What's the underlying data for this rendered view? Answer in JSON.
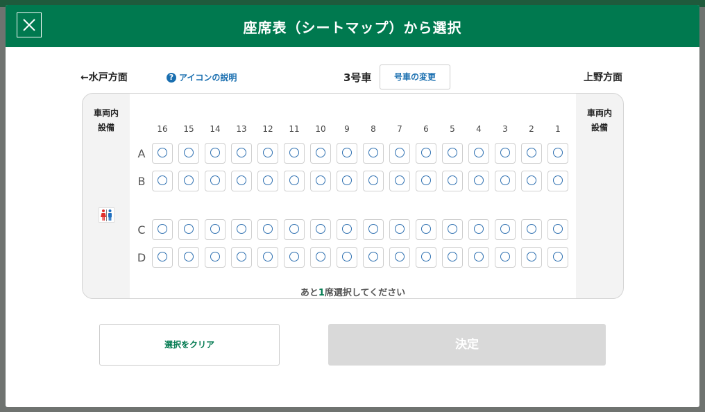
{
  "header": {
    "title": "座席表（シートマップ）から選択"
  },
  "toolbar": {
    "direction_left": "←水戸方面",
    "icon_help": "アイコンの説明",
    "car_number": "3号車",
    "change_car": "号車の変更",
    "direction_right": "上野方面"
  },
  "seatmap": {
    "facility_label_left": "車両内\n設備",
    "facility_label_right": "車両内\n設備",
    "columns": [
      "16",
      "15",
      "14",
      "13",
      "12",
      "11",
      "10",
      "9",
      "8",
      "7",
      "6",
      "5",
      "4",
      "3",
      "2",
      "1"
    ],
    "rows": [
      "A",
      "B",
      "C",
      "D"
    ],
    "seat_status": "available",
    "remaining_prefix": "あと",
    "remaining_count": "1",
    "remaining_suffix": "席選択してください",
    "facilities": [
      "toilet-icon"
    ]
  },
  "actions": {
    "clear": "選択をクリア",
    "confirm": "決定"
  },
  "colors": {
    "brand_green": "#00794f",
    "seat_circle": "#2d6fb0",
    "disabled": "#d9d9d9"
  }
}
